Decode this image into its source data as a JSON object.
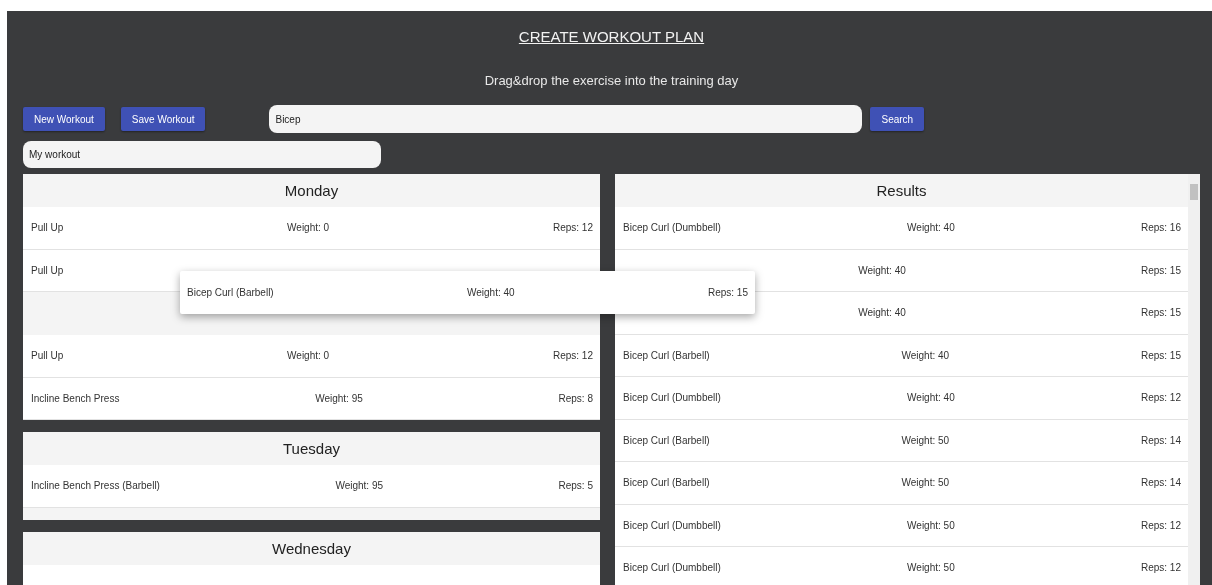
{
  "title": "CREATE WORKOUT PLAN",
  "subtitle": "Drag&drop the exercise into the training day",
  "buttons": [
    {
      "label": "New Workout"
    },
    {
      "label": "Save Workout"
    }
  ],
  "search": {
    "value": "Bicep",
    "button": "Search"
  },
  "workout_name": {
    "value": "My workout"
  },
  "days": [
    {
      "name": "Monday",
      "items": [
        {
          "kind": "exercise",
          "name": "Pull Up",
          "weight": "Weight: 0",
          "reps": "Reps: 12"
        },
        {
          "kind": "exercise",
          "name": "Pull Up"
        },
        {
          "kind": "drop_slot"
        },
        {
          "kind": "exercise",
          "name": "Pull Up",
          "weight": "Weight: 0",
          "reps": "Reps: 12"
        },
        {
          "kind": "exercise",
          "name": "Incline Bench Press",
          "weight": "Weight: 95",
          "reps": "Reps: 8"
        }
      ]
    },
    {
      "name": "Tuesday",
      "items": [
        {
          "kind": "exercise",
          "name": "Incline Bench Press (Barbell)",
          "weight": "Weight: 95",
          "reps": "Reps: 5"
        },
        {
          "kind": "gap"
        }
      ]
    },
    {
      "name": "Wednesday",
      "items": [
        {
          "kind": "exercise"
        }
      ]
    }
  ],
  "results": {
    "title": "Results",
    "items": [
      {
        "name": "Bicep Curl (Dumbbell)",
        "weight": "Weight: 40",
        "reps": "Reps: 16"
      },
      {
        "weight": "Weight: 40",
        "reps": "Reps: 15"
      },
      {
        "weight": "Weight: 40",
        "reps": "Reps: 15"
      },
      {
        "name": "Bicep Curl (Barbell)",
        "weight": "Weight: 40",
        "reps": "Reps: 15"
      },
      {
        "name": "Bicep Curl (Dumbbell)",
        "weight": "Weight: 40",
        "reps": "Reps: 12"
      },
      {
        "name": "Bicep Curl (Barbell)",
        "weight": "Weight: 50",
        "reps": "Reps: 14"
      },
      {
        "name": "Bicep Curl (Barbell)",
        "weight": "Weight: 50",
        "reps": "Reps: 14"
      },
      {
        "name": "Bicep Curl (Dumbbell)",
        "weight": "Weight: 50",
        "reps": "Reps: 12"
      },
      {
        "name": "Bicep Curl (Dumbbell)",
        "weight": "Weight: 50",
        "reps": "Reps: 12"
      }
    ]
  },
  "dragging": {
    "name": "Bicep Curl (Barbell)",
    "weight": "Weight: 40",
    "reps": "Reps: 15"
  }
}
